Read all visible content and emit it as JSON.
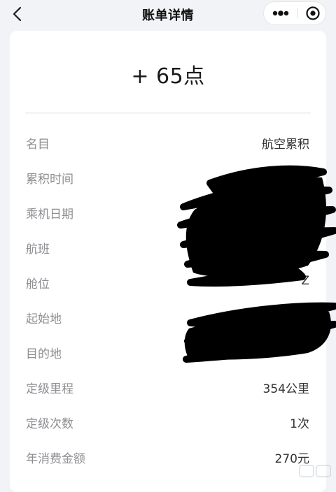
{
  "nav": {
    "title": "账单详情",
    "back_icon": "chevron-left-icon",
    "more_icon": "more-dots-icon",
    "close_icon": "mini-program-close-icon"
  },
  "record": {
    "points": "+ 65点"
  },
  "details": [
    {
      "label": "名目",
      "value": "航空累积"
    },
    {
      "label": "累积时间",
      "value": ""
    },
    {
      "label": "乘机日期",
      "value": ""
    },
    {
      "label": "航班",
      "value": ""
    },
    {
      "label": "舱位",
      "value": "Z"
    },
    {
      "label": "起始地",
      "value": ""
    },
    {
      "label": "目的地",
      "value": ""
    },
    {
      "label": "定级里程",
      "value": "354公里"
    },
    {
      "label": "定级次数",
      "value": "1次"
    },
    {
      "label": "年消费金额",
      "value": "270元"
    }
  ],
  "colors": {
    "background": "#f2f3f6",
    "card": "#ffffff",
    "label": "#8e8e93",
    "value": "#333333",
    "redaction": "#000000"
  }
}
